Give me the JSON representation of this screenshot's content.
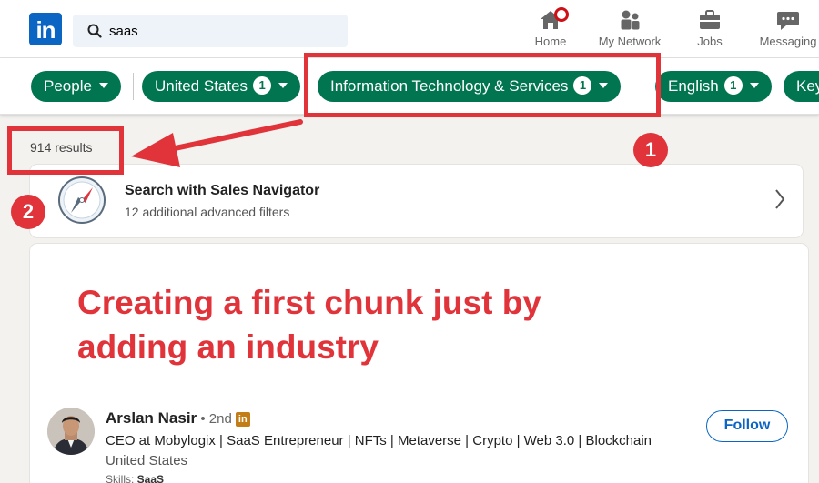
{
  "nav": {
    "logo_text": "in",
    "search_value": "saas",
    "items": [
      {
        "label": "Home",
        "icon": "home-icon"
      },
      {
        "label": "My Network",
        "icon": "network-icon"
      },
      {
        "label": "Jobs",
        "icon": "briefcase-icon"
      },
      {
        "label": "Messaging",
        "icon": "messaging-icon"
      }
    ]
  },
  "filters": {
    "people_label": "People",
    "pills": [
      {
        "label": "United States",
        "count": "1"
      },
      {
        "label": "Information Technology & Services",
        "count": "1"
      },
      {
        "label": "English",
        "count": "1"
      },
      {
        "label": "Key"
      }
    ]
  },
  "annotations": {
    "step1": "1",
    "step2": "2",
    "overlay_line1": "Creating a first chunk just by",
    "overlay_line2": "adding an industry",
    "color": "#e0333a"
  },
  "results": {
    "count_text": "914 results",
    "sales_navigator": {
      "title": "Search with Sales Navigator",
      "subtitle": "12 additional advanced filters"
    },
    "person": {
      "name": "Arslan Nasir",
      "degree": " • 2nd",
      "headline": "CEO at Mobylogix | SaaS Entrepreneur | NFTs | Metaverse | Crypto | Web 3.0 | Blockchain",
      "location": "United States",
      "skills_label": "Skills: ",
      "skills_value": "SaaS",
      "follow_label": "Follow"
    }
  },
  "colors": {
    "brand": "#0a66c2",
    "filter_green": "#01754f",
    "annotation_red": "#e0333a"
  }
}
